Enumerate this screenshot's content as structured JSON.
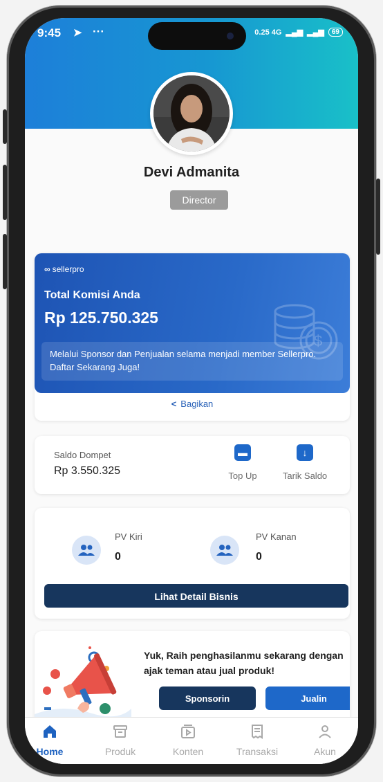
{
  "status_bar": {
    "time": "9:45",
    "signal_text": "0.25 4G",
    "battery": "69"
  },
  "profile": {
    "name": "Devi Admanita",
    "role": "Director"
  },
  "komisi": {
    "brand": "sellerpro",
    "title": "Total Komisi Anda",
    "amount": "Rp 125.750.325",
    "note": "Melalui Sponsor dan Penjualan selama menjadi member Sellerpro. Daftar Sekarang Juga!",
    "share_label": "Bagikan"
  },
  "wallet": {
    "label": "Saldo Dompet",
    "value": "Rp 3.550.325",
    "topup_label": "Top Up",
    "withdraw_label": "Tarik Saldo"
  },
  "pv": {
    "left_label": "PV Kiri",
    "left_value": "0",
    "right_label": "PV Kanan",
    "right_value": "0",
    "detail_button": "Lihat Detail Bisnis"
  },
  "promo": {
    "text": "Yuk, Raih penghasilanmu sekarang dengan ajak teman atau jual produk!",
    "sponsor_button": "Sponsorin",
    "sell_button": "Jualin"
  },
  "nav": [
    {
      "label": "Home",
      "icon": "home-icon",
      "active": true
    },
    {
      "label": "Produk",
      "icon": "box-icon",
      "active": false
    },
    {
      "label": "Konten",
      "icon": "video-icon",
      "active": false
    },
    {
      "label": "Transaksi",
      "icon": "receipt-icon",
      "active": false
    },
    {
      "label": "Akun",
      "icon": "user-icon",
      "active": false
    }
  ],
  "colors": {
    "header_gradient_start": "#1d7fd9",
    "header_gradient_end": "#19c0c8",
    "card_blue": "#1e54b4",
    "dark_button": "#17365d",
    "accent": "#1e62c0",
    "role_badge": "#9b9b9b"
  }
}
